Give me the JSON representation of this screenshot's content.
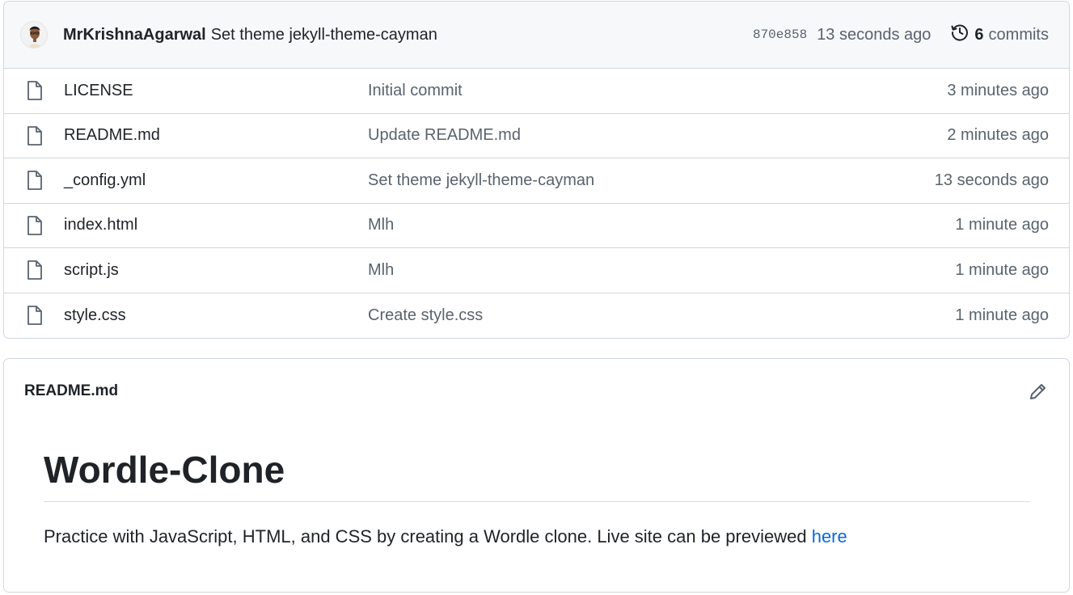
{
  "commit": {
    "author": "MrKrishnaAgarwal",
    "message": "Set theme jekyll-theme-cayman",
    "sha": "870e858",
    "time": "13 seconds ago",
    "commits_count": "6",
    "commits_label": "commits"
  },
  "files": [
    {
      "name": "LICENSE",
      "message": "Initial commit",
      "time": "3 minutes ago",
      "icon": "file-icon"
    },
    {
      "name": "README.md",
      "message": "Update README.md",
      "time": "2 minutes ago",
      "icon": "file-icon"
    },
    {
      "name": "_config.yml",
      "message": "Set theme jekyll-theme-cayman",
      "time": "13 seconds ago",
      "icon": "file-icon"
    },
    {
      "name": "index.html",
      "message": "Mlh",
      "time": "1 minute ago",
      "icon": "file-icon"
    },
    {
      "name": "script.js",
      "message": "Mlh",
      "time": "1 minute ago",
      "icon": "file-icon"
    },
    {
      "name": "style.css",
      "message": "Create style.css",
      "time": "1 minute ago",
      "icon": "file-icon"
    }
  ],
  "readme": {
    "filename": "README.md",
    "heading": "Wordle-Clone",
    "paragraph": "Practice with JavaScript, HTML, and CSS by creating a Wordle clone. Live site can be previewed ",
    "link_text": "here"
  },
  "colors": {
    "link": "#0969da",
    "muted": "#59636e",
    "border": "#d0d7de",
    "header_bg": "#f6f8fa"
  }
}
